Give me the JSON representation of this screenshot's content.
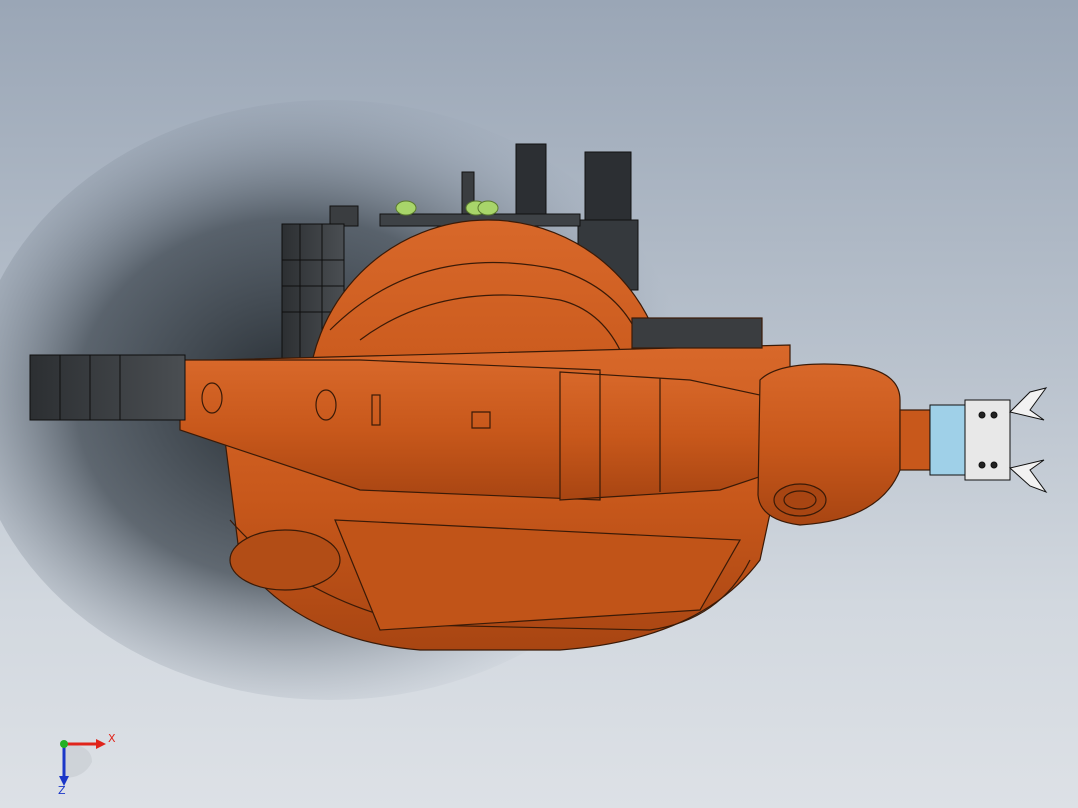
{
  "viewport": {
    "background": "#b9c2cd",
    "model_color": "#c8581b",
    "dark_part_color": "#3a3d40",
    "accent_green": "#a8d56a",
    "gripper_blue": "#9fd0e8"
  },
  "model": {
    "parts": [
      "base-housing",
      "rotary-drum",
      "motor-pack",
      "upper-arm",
      "forearm",
      "wrist-yoke",
      "gripper"
    ]
  },
  "triad": {
    "x_label": "X",
    "z_label": "Z",
    "x_color": "#e0241b",
    "z_color": "#1b37c8",
    "y_color": "#22b022"
  }
}
